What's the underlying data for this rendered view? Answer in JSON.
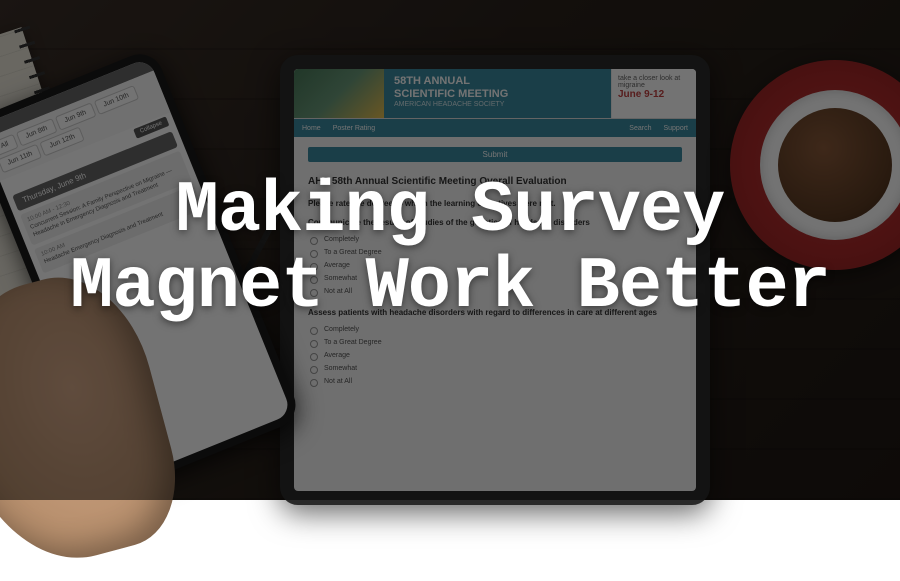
{
  "headline": {
    "line1": "Making Survey",
    "line2": "Magnet Work Better"
  },
  "tablet": {
    "header": {
      "title_line1": "58TH ANNUAL",
      "title_line2": "SCIENTIFIC MEETING",
      "title_line3": "AMERICAN HEADACHE SOCIETY",
      "tagline": "take a closer look at migraine",
      "date": "June 9-12"
    },
    "nav": {
      "left": [
        "Home",
        "Poster Rating"
      ],
      "right": [
        "Search",
        "Support"
      ]
    },
    "submit_label": "Submit",
    "survey": {
      "title": "AHS 58th Annual Scientific Meeting Overall Evaluation",
      "intro": "Please rate the degree to which the learning objectives were met.",
      "questions": [
        {
          "text": "Communicate the results of studies of the genetics of headache disorders",
          "options": [
            "Completely",
            "To a Great Degree",
            "Average",
            "Somewhat",
            "Not at All"
          ]
        },
        {
          "text": "Assess patients with headache disorders with regard to differences in care at different ages",
          "options": [
            "Completely",
            "To a Great Degree",
            "Average",
            "Somewhat",
            "Not at All"
          ]
        }
      ]
    }
  },
  "phone": {
    "tabs": [
      "All",
      "Jun 8th",
      "Jun 9th",
      "Jun 10th",
      "Jun 11th",
      "Jun 12th"
    ],
    "collapse_label": "Collapse",
    "day_label": "Thursday, June 9th",
    "sessions": [
      {
        "time": "10:00 AM - 12:30",
        "title": "Concurrent Session: A Family Perspective on Migraine — Headache in Emergency Diagnosis and Treatment"
      },
      {
        "time": "10:00 AM",
        "title": "Headache Emergency Diagnosis and Treatment"
      }
    ]
  }
}
